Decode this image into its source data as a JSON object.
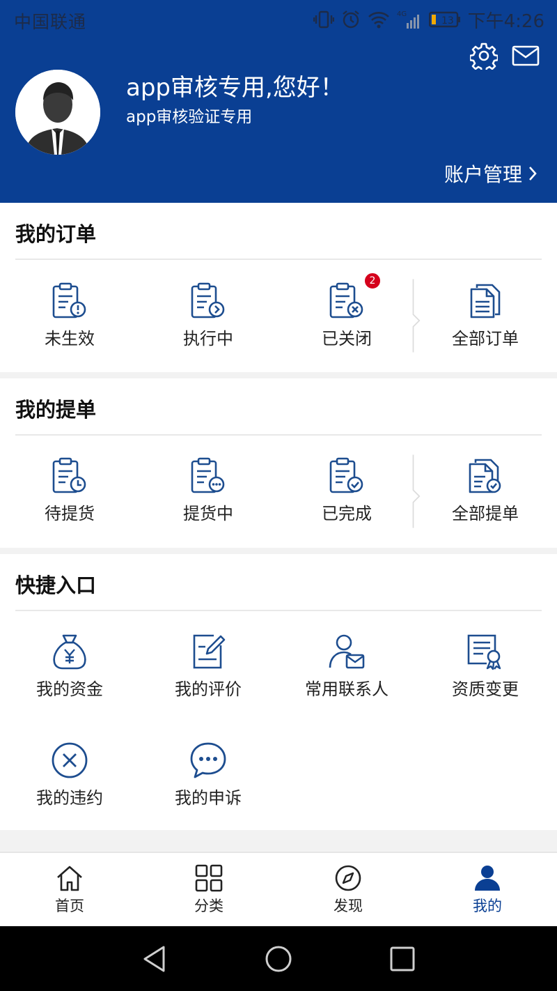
{
  "status_bar": {
    "carrier": "中国联通",
    "time": "下午4:26",
    "network": "4G",
    "battery": "13"
  },
  "header": {
    "greeting": "app审核专用,您好！",
    "subtitle": "app审核验证专用",
    "account_link": "账户管理",
    "background_color": "#0a3f93"
  },
  "orders": {
    "title": "我的订单",
    "items": [
      {
        "label": "未生效",
        "icon": "clipboard-alert-icon"
      },
      {
        "label": "执行中",
        "icon": "clipboard-arrow-icon"
      },
      {
        "label": "已关闭",
        "icon": "clipboard-close-icon",
        "badge": "2"
      },
      {
        "label": "全部订单",
        "icon": "documents-icon"
      }
    ]
  },
  "bills": {
    "title": "我的提单",
    "items": [
      {
        "label": "待提货",
        "icon": "clipboard-clock-icon"
      },
      {
        "label": "提货中",
        "icon": "clipboard-dots-icon"
      },
      {
        "label": "已完成",
        "icon": "clipboard-check-icon"
      },
      {
        "label": "全部提单",
        "icon": "documents-check-icon"
      }
    ]
  },
  "shortcuts": {
    "title": "快捷入口",
    "items": [
      {
        "label": "我的资金",
        "icon": "money-bag-icon"
      },
      {
        "label": "我的评价",
        "icon": "edit-note-icon"
      },
      {
        "label": "常用联系人",
        "icon": "contact-mail-icon"
      },
      {
        "label": "资质变更",
        "icon": "certificate-icon"
      },
      {
        "label": "我的违约",
        "icon": "close-circle-icon"
      },
      {
        "label": "我的申诉",
        "icon": "chat-bubble-icon"
      }
    ]
  },
  "tabbar": {
    "items": [
      {
        "label": "首页",
        "icon": "home-icon"
      },
      {
        "label": "分类",
        "icon": "grid-icon"
      },
      {
        "label": "发现",
        "icon": "compass-icon"
      },
      {
        "label": "我的",
        "icon": "user-icon",
        "active": true
      }
    ]
  },
  "colors": {
    "primary": "#0a3f93",
    "icon_blue": "#1d4d8f",
    "badge_red": "#d5001c"
  }
}
